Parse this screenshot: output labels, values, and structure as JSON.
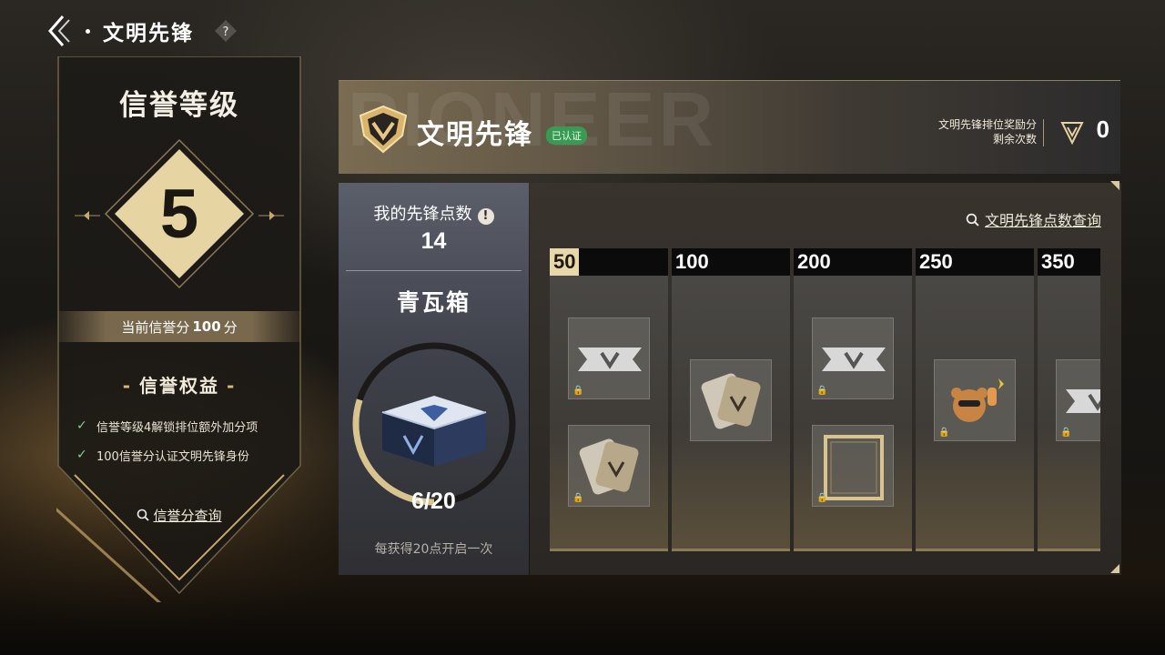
{
  "topbar": {
    "title": "文明先锋",
    "help_icon": "question-icon",
    "back_icon": "chevron-left-icon"
  },
  "credit": {
    "title": "信誉等级",
    "level": "5",
    "score_prefix": "当前信誉分",
    "score_value": "100",
    "score_suffix": "分",
    "benefits_title": "信誉权益",
    "benefits": [
      "信誉等级4解锁排位额外加分项",
      "100信誉分认证文明先锋身份"
    ],
    "query_label": "信誉分查询"
  },
  "header": {
    "bg_word": "PIONEER",
    "title": "文明先锋",
    "verified": "已认证",
    "reward_label_1": "文明先锋排位奖励分",
    "reward_label_2": "剩余次数",
    "reward_count": "0"
  },
  "points": {
    "label": "我的先锋点数",
    "value": "14",
    "box_name": "青瓦箱",
    "progress": "6/20",
    "progress_fraction": 0.3,
    "hint": "每获得20点开启一次"
  },
  "rewards": {
    "query_label": "文明先锋点数查询",
    "tiers": [
      {
        "threshold": "50",
        "active": true,
        "items": [
          "flag-icon",
          "dogtag-icon"
        ]
      },
      {
        "threshold": "100",
        "active": false,
        "items": [
          "dogtag-icon"
        ]
      },
      {
        "threshold": "200",
        "active": false,
        "items": [
          "flag-icon",
          "card-frame-icon"
        ]
      },
      {
        "threshold": "250",
        "active": false,
        "items": [
          "bear-sticker-icon"
        ]
      },
      {
        "threshold": "350",
        "active": false,
        "items": [
          "flag-icon"
        ]
      }
    ]
  },
  "colors": {
    "gold": "#e8d7a8",
    "check": "#7fd08f",
    "verified": "#3a9a54"
  }
}
